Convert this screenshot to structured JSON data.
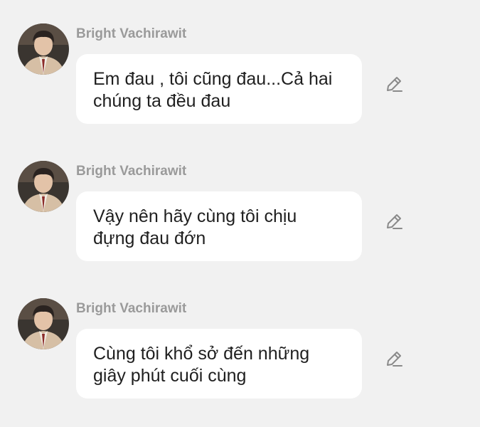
{
  "messages": [
    {
      "sender": "Bright Vachirawit",
      "line1": "Em đau , tôi cũng đau...Cả hai",
      "line2": "chúng ta đều đau",
      "icon": "pencil-icon"
    },
    {
      "sender": "Bright Vachirawit",
      "line1": "Vậy nên hãy cùng tôi chịu",
      "line2": "đựng đau đớn",
      "icon": "pencil-icon"
    },
    {
      "sender": "Bright Vachirawit",
      "line1": "Cùng tôi khổ sở đến những",
      "line2": "giây phút cuối cùng",
      "icon": "pencil-icon"
    }
  ]
}
